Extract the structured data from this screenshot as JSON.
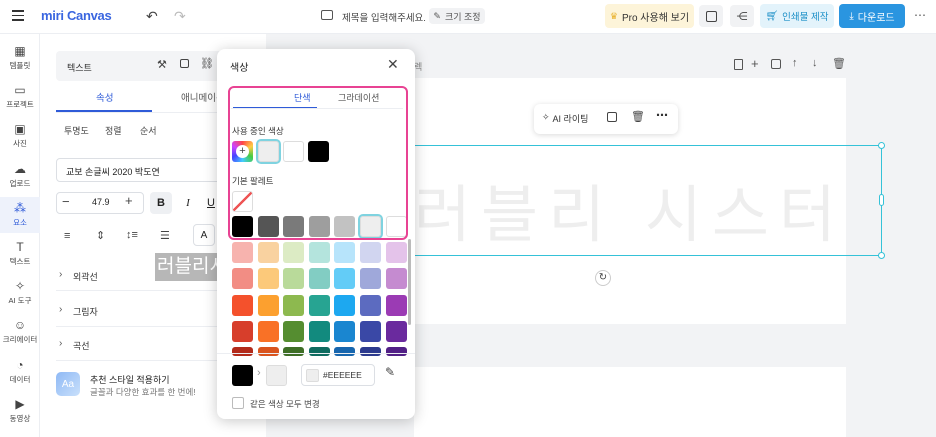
{
  "header": {
    "logo": "miri Canvas",
    "title_placeholder": "제목을 입력해주세요.",
    "resize_label": "크기 조정",
    "pro_label": "Pro 사용해 보기",
    "print_label": "인쇄물 제작",
    "download_label": "다운로드",
    "more": "⋯"
  },
  "nav": [
    {
      "label": "템플릿",
      "icon": "template-icon"
    },
    {
      "label": "프로젝트",
      "icon": "project-icon"
    },
    {
      "label": "사진",
      "icon": "photo-icon"
    },
    {
      "label": "업로드",
      "icon": "upload-icon"
    },
    {
      "label": "요소",
      "icon": "elements-icon",
      "active": true
    },
    {
      "label": "텍스트",
      "icon": "text-icon"
    },
    {
      "label": "AI 도구",
      "icon": "ai-tool-icon"
    },
    {
      "label": "크리에이터",
      "icon": "creator-icon"
    },
    {
      "label": "데이터",
      "icon": "data-icon"
    },
    {
      "label": "동영상",
      "icon": "video-icon"
    }
  ],
  "panel": {
    "title": "텍스트",
    "tabs": [
      "속성",
      "애니메이션"
    ],
    "subtabs": [
      "투명도",
      "정렬",
      "순서"
    ],
    "font_name": "교보 손글씨 2020 박도연",
    "font_size": "47.9",
    "style_buttons": [
      "B",
      "I",
      "U"
    ],
    "sections": [
      "외곽선",
      "그림자",
      "곡선"
    ],
    "recommend_title": "추천 스타일 적용하기",
    "recommend_desc": "글꼴과 다양한 효과를 한 번에!",
    "recommend_badge": "Aa",
    "color_btn_letter": "A"
  },
  "drag_preview": "러블리시스터즈",
  "canvas": {
    "page_label": "렉",
    "text": "러블리 시스터즈",
    "ai_rewrite_label": "AI 라이팅"
  },
  "color_picker": {
    "title": "색상",
    "tabs": [
      "단색",
      "그라데이션"
    ],
    "active_tab": 0,
    "in_use_label": "사용 중인 색상",
    "in_use_colors": [
      "#EEEEEE",
      "#FFFFFF",
      "#000000"
    ],
    "palette_label": "기본 팔레트",
    "gray_row": [
      "#000000",
      "#555555",
      "#7A7A7A",
      "#9E9E9E",
      "#C2C2C2",
      "#EEEEEE",
      "#FFFFFF"
    ],
    "palette_rows": [
      [
        "#F7B3AE",
        "#F9D2A0",
        "#DCEBC4",
        "#B4E4DD",
        "#B7E4FB",
        "#D1D5F0",
        "#E4C3EA"
      ],
      [
        "#F28D84",
        "#FCC97A",
        "#B9DA9A",
        "#82CDC3",
        "#63CCF7",
        "#9FA8DA",
        "#C58BD0"
      ],
      [
        "#F4512C",
        "#FCA02F",
        "#8DB94F",
        "#27A492",
        "#1DA8F0",
        "#5C6BC0",
        "#9B3BB4"
      ],
      [
        "#D73E2B",
        "#F97126",
        "#558D30",
        "#128A7E",
        "#1A86D0",
        "#3A48A6",
        "#6A2A9E"
      ],
      [
        "#B22A1A",
        "#D9541E",
        "#3E6E26",
        "#0E6B5F",
        "#1766AE",
        "#2C3A8E",
        "#511F86"
      ]
    ],
    "from_color": "#000000",
    "to_color": "#EEEEEE",
    "hex_value": "#EEEEEE",
    "apply_all_label": "같은 색상 모두 변경",
    "highlight_color": "#E84393"
  }
}
